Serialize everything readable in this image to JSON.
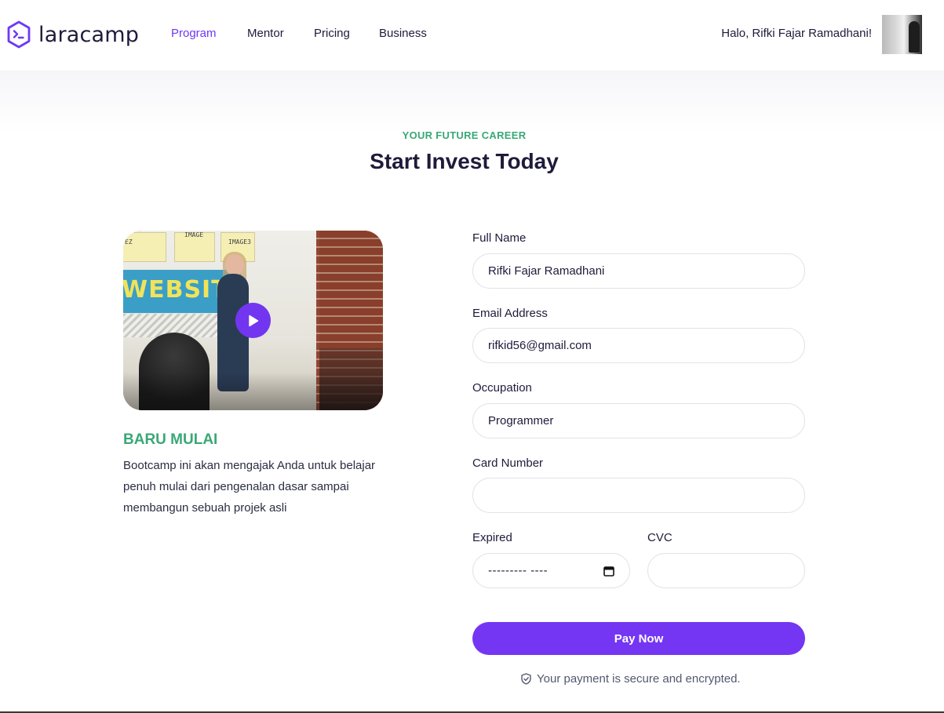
{
  "nav": {
    "logo_text": "laracamp",
    "items": [
      {
        "label": "Program",
        "active": true
      },
      {
        "label": "Mentor",
        "active": false
      },
      {
        "label": "Pricing",
        "active": false
      },
      {
        "label": "Business",
        "active": false
      }
    ],
    "greeting": "Halo, Rifki Fajar Ramadhani!"
  },
  "hero": {
    "eyebrow": "YOUR FUTURE CAREER",
    "title": "Start Invest Today"
  },
  "card": {
    "video_banner": "WEBSITE",
    "video_notes": [
      "IMAGE",
      "IMAGE3",
      "EZ"
    ],
    "title": "BARU MULAI",
    "description": "Bootcamp ini akan mengajak Anda untuk belajar penuh mulai dari pengenalan dasar sampai membangun sebuah projek asli"
  },
  "form": {
    "full_name": {
      "label": "Full Name",
      "value": "Rifki Fajar Ramadhani"
    },
    "email": {
      "label": "Email Address",
      "value": "rifkid56@gmail.com"
    },
    "occupation": {
      "label": "Occupation",
      "value": "Programmer"
    },
    "card_number": {
      "label": "Card Number",
      "value": ""
    },
    "expired": {
      "label": "Expired",
      "placeholder": "--------- ----"
    },
    "cvc": {
      "label": "CVC",
      "value": ""
    },
    "submit_label": "Pay Now",
    "secure_note": "Your payment is secure and encrypted."
  },
  "colors": {
    "accent": "#7536f3",
    "green": "#3aa876",
    "text": "#1e1b3a"
  }
}
